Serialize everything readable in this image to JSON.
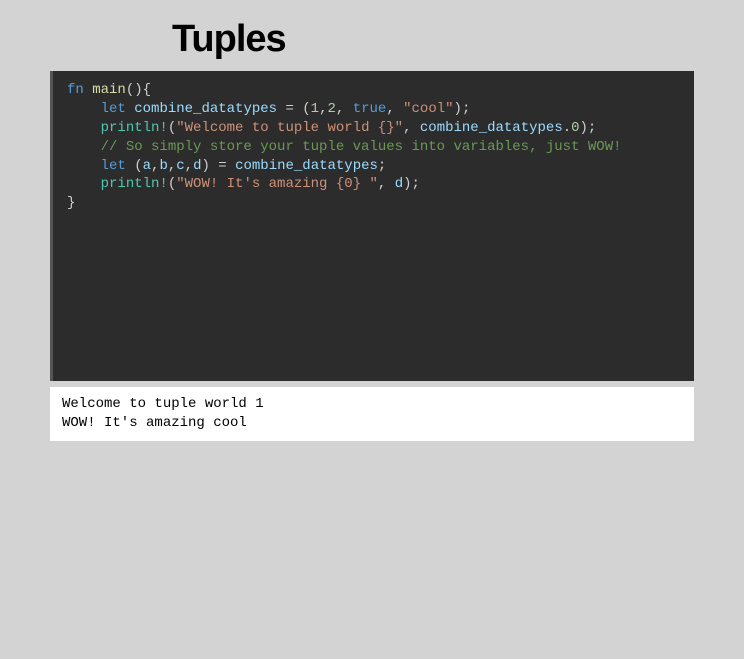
{
  "title": "Tuples",
  "code": {
    "line1": {
      "fn": "fn",
      "main": "main",
      "rest": "(){"
    },
    "line2_blank": "",
    "line3": {
      "indent": "    ",
      "let": "let",
      "var": "combine_datatypes",
      "eq": " = (",
      "n1": "1",
      "c1": ",",
      "n2": "2",
      "c2": ", ",
      "true": "true",
      "c3": ", ",
      "str": "\"cool\"",
      "end": ");"
    },
    "line4": {
      "indent": "    ",
      "macro": "println!",
      "open": "(",
      "str": "\"Welcome to tuple world {}\"",
      "c1": ", ",
      "var": "combine_datatypes",
      "dot": ".",
      "n0": "0",
      "end": ");"
    },
    "line5_blank": "",
    "line6_blank": "",
    "line7": {
      "indent": "    ",
      "comment": "// So simply store your tuple values into variables, just WOW!"
    },
    "line8": {
      "indent": "    ",
      "let": "let",
      "open": " (",
      "a": "a",
      "c1": ",",
      "b": "b",
      "c2": ",",
      "c": "c",
      "c3": ",",
      "d": "d",
      "close": ") = ",
      "var": "combine_datatypes",
      "end": ";"
    },
    "line9": {
      "indent": "    ",
      "macro": "println!",
      "open": "(",
      "str": "\"WOW! It's amazing {0} \"",
      "c1": ", ",
      "d": "d",
      "end": ");"
    },
    "line10": {
      "brace": "}"
    }
  },
  "output": {
    "line1": "Welcome to tuple world 1",
    "line2": "WOW! It's amazing cool "
  }
}
